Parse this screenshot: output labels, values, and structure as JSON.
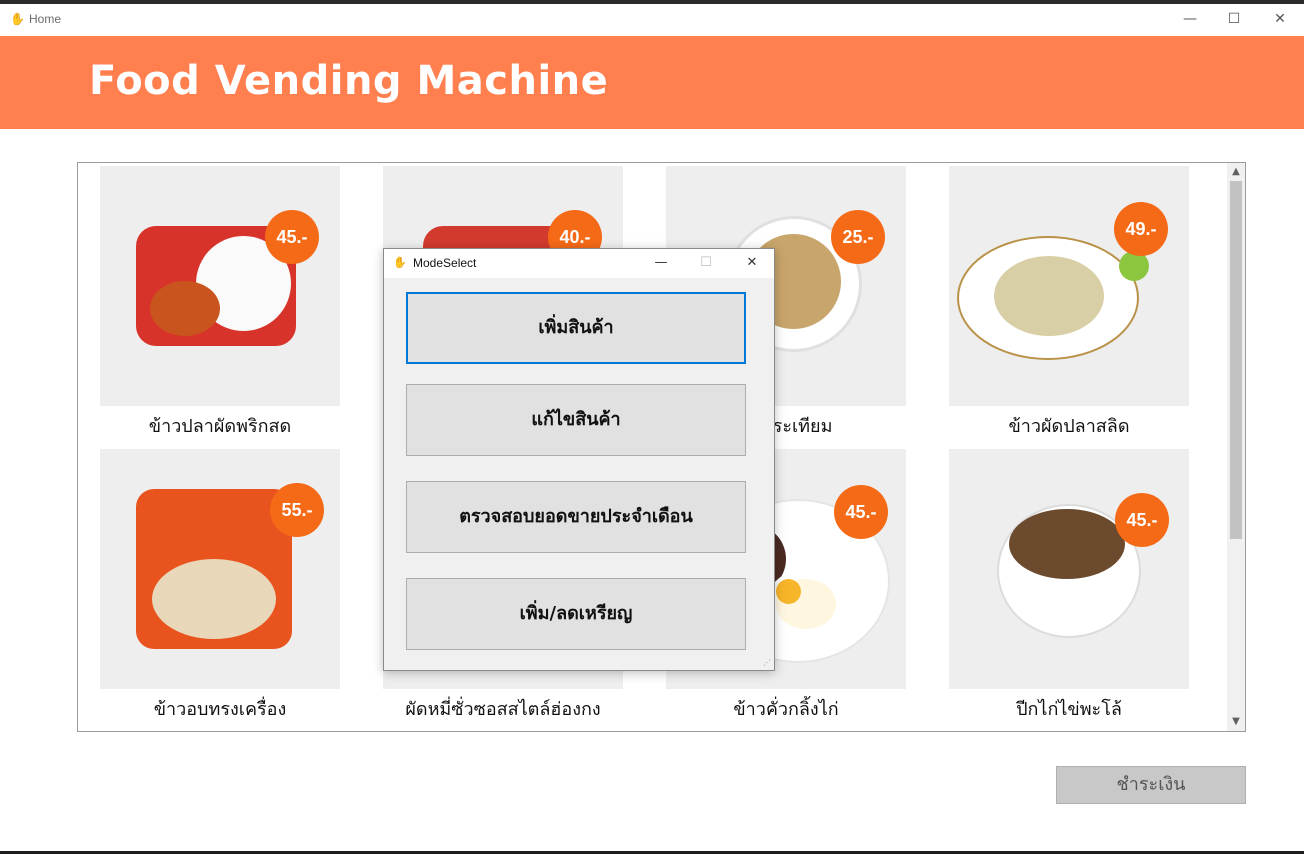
{
  "window": {
    "title": "Home",
    "minimize": "—",
    "maximize": "☐",
    "close": "✕"
  },
  "header": {
    "brand": "Food Vending Machine"
  },
  "products": [
    {
      "name": "ข้าวปลาผัดพริกสด",
      "price": "45.-"
    },
    {
      "name": "",
      "price": "40.-"
    },
    {
      "name": "ผัดกระเทียม",
      "price": "25.-"
    },
    {
      "name": "ข้าวผัดปลาสลิด",
      "price": "49.-"
    },
    {
      "name": "ข้าวอบทรงเครื่อง",
      "price": "55.-"
    },
    {
      "name": "ผัดหมี่ซั่วซอสสไตล์ฮ่องกง",
      "price": ""
    },
    {
      "name": "ข้าวคั่วกลิ้งไก่",
      "price": "45.-"
    },
    {
      "name": "ปีกไก่ไข่พะโล้",
      "price": "45.-"
    }
  ],
  "pay_button": "ชำระเงิน",
  "modal": {
    "title": "ModeSelect",
    "minimize": "—",
    "maximize": "☐",
    "close": "✕",
    "actions": [
      "เพิ่มสินค้า",
      "แก้ไขสินค้า",
      "ตรวจสอบยอดขายประจำเดือน",
      "เพิ่ม/ลดเหรียญ"
    ]
  },
  "colors": {
    "header": "#ff7f4f",
    "price_badge": "#f56a17",
    "focus": "#0078d7"
  }
}
